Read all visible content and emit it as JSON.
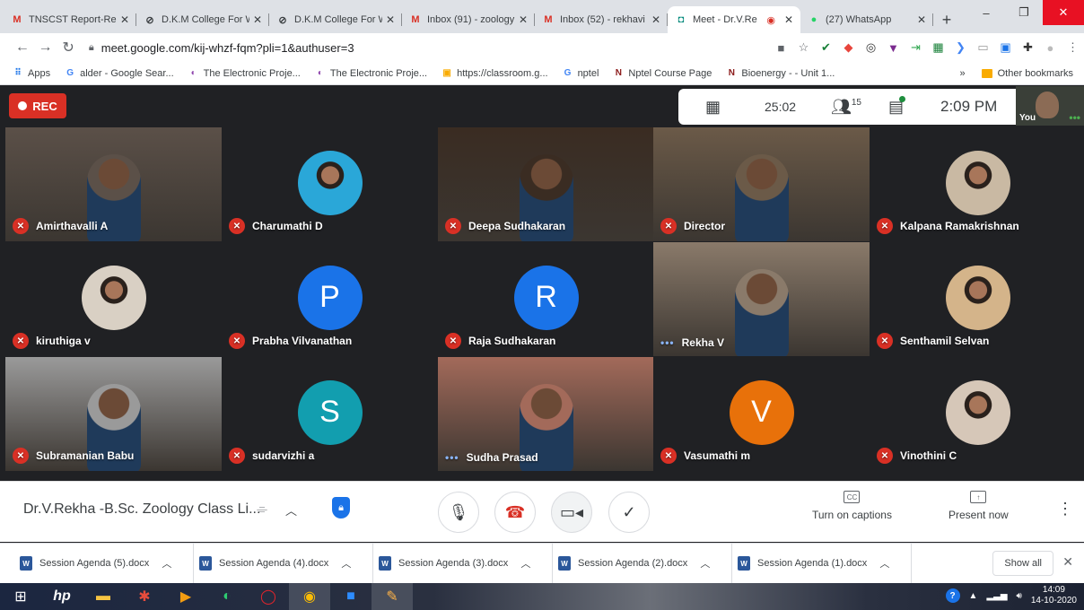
{
  "browser": {
    "tabs": [
      {
        "title": "TNSCST Report-Re",
        "icon": "gmail-icon",
        "icon_glyph": "M",
        "icon_color": "#d93025",
        "active": false
      },
      {
        "title": "D.K.M College For W",
        "icon": "web-icon",
        "icon_glyph": "⊘",
        "icon_color": "#3c4043",
        "active": false
      },
      {
        "title": "D.K.M College For W",
        "icon": "web-icon",
        "icon_glyph": "⊘",
        "icon_color": "#3c4043",
        "active": false
      },
      {
        "title": "Inbox (91) - zoology",
        "icon": "gmail-icon",
        "icon_glyph": "M",
        "icon_color": "#d93025",
        "active": false
      },
      {
        "title": "Inbox (52) - rekhavi",
        "icon": "gmail-icon",
        "icon_glyph": "M",
        "icon_color": "#d93025",
        "active": false
      },
      {
        "title": "Meet - Dr.V.Re",
        "icon": "meet-icon",
        "icon_glyph": "◘",
        "icon_color": "#00897b",
        "active": true
      },
      {
        "title": "(27) WhatsApp",
        "icon": "whatsapp-icon",
        "icon_glyph": "●",
        "icon_color": "#25d366",
        "active": false
      }
    ],
    "url": "meet.google.com/kij-whzf-fqm?pli=1&authuser=3",
    "bookmarks": [
      {
        "label": "Apps",
        "icon": "apps-icon",
        "glyph": "⠿",
        "color": "#1a73e8"
      },
      {
        "label": "alder - Google Sear...",
        "icon": "google-icon",
        "glyph": "G",
        "color": "#4285f4"
      },
      {
        "label": "The Electronic Proje...",
        "icon": "web-icon",
        "glyph": "◐",
        "color": "#8e44ad"
      },
      {
        "label": "The Electronic Proje...",
        "icon": "web-icon",
        "glyph": "◐",
        "color": "#8e44ad"
      },
      {
        "label": "https://classroom.g...",
        "icon": "classroom-icon",
        "glyph": "▣",
        "color": "#f9ab00"
      },
      {
        "label": "nptel",
        "icon": "google-icon",
        "glyph": "G",
        "color": "#4285f4"
      },
      {
        "label": "Nptel Course Page",
        "icon": "nptel-icon",
        "glyph": "N",
        "color": "#8b1a1a"
      },
      {
        "label": "Bioenergy - - Unit 1...",
        "icon": "nptel-icon",
        "glyph": "N",
        "color": "#8b1a1a"
      }
    ],
    "bookmarks_more": "»",
    "other_bookmarks": "Other bookmarks"
  },
  "meet": {
    "rec_label": "REC",
    "timer": "25:02",
    "participants_count": "15",
    "clock": "2:09 PM",
    "self_label": "You",
    "tiles": [
      {
        "name": "Amirthavalli A",
        "kind": "video",
        "muted": true,
        "bg": "#5b5048"
      },
      {
        "name": "Charumathi D",
        "kind": "photo",
        "muted": true,
        "bg": "#2aa7d8"
      },
      {
        "name": "Deepa Sudhakaran",
        "kind": "video",
        "muted": true,
        "bg": "#3a2c22"
      },
      {
        "name": "Director",
        "kind": "video",
        "muted": true,
        "bg": "#6b5a48"
      },
      {
        "name": "Kalpana Ramakrishnan",
        "kind": "photo",
        "muted": true,
        "bg": "#c9b9a3"
      },
      {
        "name": "kiruthiga v",
        "kind": "photo",
        "muted": true,
        "bg": "#d9d0c4"
      },
      {
        "name": "Prabha Vilvanathan",
        "kind": "letter",
        "letter": "P",
        "muted": true,
        "bg": "#1a73e8"
      },
      {
        "name": "Raja Sudhakaran",
        "kind": "letter",
        "letter": "R",
        "muted": true,
        "bg": "#1a73e8"
      },
      {
        "name": "Rekha V",
        "kind": "video",
        "muted": false,
        "bg": "#8a7a6a"
      },
      {
        "name": "Senthamil Selvan",
        "kind": "photo",
        "muted": true,
        "bg": "#d4b48a"
      },
      {
        "name": "Subramanian Babu",
        "kind": "video",
        "muted": true,
        "bg": "#9a9a9a"
      },
      {
        "name": "sudarvizhi a",
        "kind": "letter",
        "letter": "S",
        "muted": true,
        "bg": "#129eaf"
      },
      {
        "name": "Sudha Prasad",
        "kind": "video",
        "muted": false,
        "bg": "#a36a5a"
      },
      {
        "name": "Vasumathi m",
        "kind": "letter",
        "letter": "V",
        "muted": true,
        "bg": "#e8710a"
      },
      {
        "name": "Vinothini C",
        "kind": "photo",
        "muted": true,
        "bg": "#d6c7b8"
      }
    ],
    "meeting_title": "Dr.V.Rekha -B.Sc. Zoology Class Li...",
    "captions_label": "Turn on captions",
    "present_label": "Present now"
  },
  "downloads": [
    "Session Agenda (5).docx",
    "Session Agenda (4).docx",
    "Session Agenda (3).docx",
    "Session Agenda (2).docx",
    "Session Agenda (1).docx"
  ],
  "show_all": "Show all",
  "taskbar": {
    "time": "14:09",
    "date": "14-10-2020"
  }
}
